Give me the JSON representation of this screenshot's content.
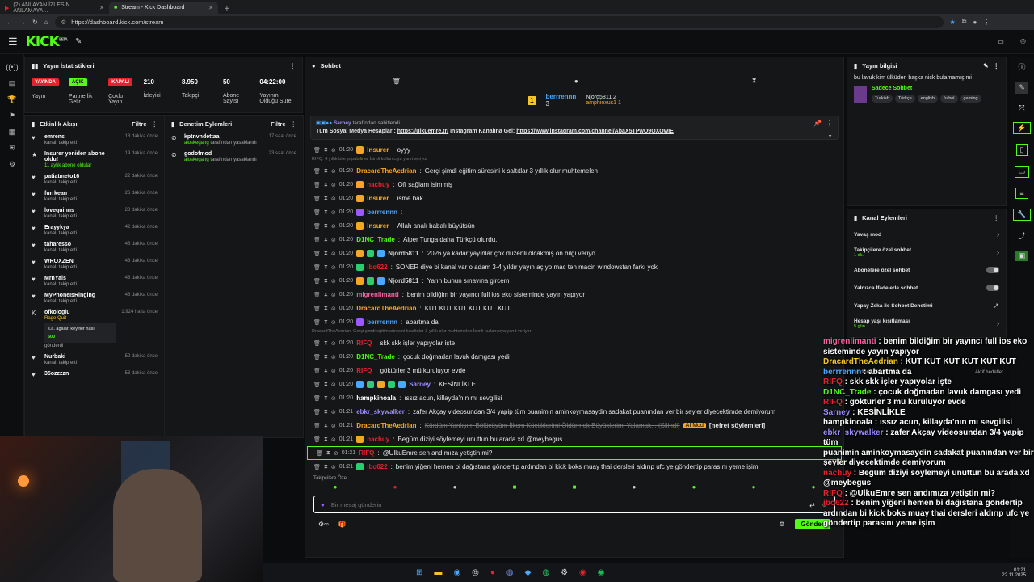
{
  "browser": {
    "tabs": [
      {
        "label": "(2) ANLAYAN İZLESİN ANLAMAYA..."
      },
      {
        "label": "Stream - Kick Dashboard"
      }
    ],
    "url": "https://dashboard.kick.com/stream"
  },
  "header": {
    "logo": "KICK",
    "logo_badge": "BETA"
  },
  "stats": {
    "title": "Yayın İstatistikleri",
    "items": [
      {
        "badge": "YAYINDA",
        "color": "#e5232d",
        "label": "Yayın"
      },
      {
        "badge": "AÇIK",
        "color": "#53fc18",
        "label": "Partnerlik Gelir"
      },
      {
        "badge": "KAPALI",
        "color": "#e5232d",
        "label": "Çoklu Yayın"
      },
      {
        "value": "210",
        "label": "İzleyici"
      },
      {
        "value": "8.950",
        "label": "Takipçi"
      },
      {
        "value": "50",
        "label": "Abone Sayısı"
      },
      {
        "value": "04:22:00",
        "label": "Yayının Olduğu Süre"
      }
    ]
  },
  "activity": {
    "title": "Etkinlik Akışı",
    "filter": "Filtre",
    "items": [
      {
        "icon": "♥",
        "name": "emrens",
        "desc": "kanalı takip etti",
        "time": "18 dakika önce"
      },
      {
        "icon": "★",
        "name": "Insurer yeniden abone oldu!",
        "desc": "11 aylık abone oldular",
        "time": "19 dakika önce",
        "green": true
      },
      {
        "icon": "♥",
        "name": "patiatmeto16",
        "desc": "kanalı takip etti",
        "time": "22 dakika önce"
      },
      {
        "icon": "♥",
        "name": "furrkean",
        "desc": "kanalı takip etti",
        "time": "26 dakika önce"
      },
      {
        "icon": "♥",
        "name": "lovequinns",
        "desc": "kanalı takip etti",
        "time": "28 dakika önce"
      },
      {
        "icon": "♥",
        "name": "Erayykya",
        "desc": "kanalı takip etti",
        "time": "42 dakika önce"
      },
      {
        "icon": "♥",
        "name": "taharesso",
        "desc": "kanalı takip etti",
        "time": "43 dakika önce"
      },
      {
        "icon": "♥",
        "name": "WROXZEN",
        "desc": "kanalı takip etti",
        "time": "43 dakika önce"
      },
      {
        "icon": "♥",
        "name": "MrnYals",
        "desc": "kanalı takip etti",
        "time": "43 dakika önce"
      },
      {
        "icon": "♥",
        "name": "MyPhoneIsRinging",
        "desc": "kanalı takip etti",
        "time": "48 dakika önce"
      }
    ],
    "kick_item": {
      "name": "ofkologlu",
      "sub": "Rage Quit",
      "time": "1.924 hafta önce",
      "msg": "s.a. agalar, keyifler nasıl",
      "amount": "500",
      "desc": "gönderdi"
    },
    "last": {
      "name": "Nurbaki",
      "desc": "kanalı takip etti",
      "time": "52 dakika önce"
    },
    "partial": {
      "name": "35ozzzzn",
      "time": "53 dakika önce"
    }
  },
  "moderation": {
    "title": "Denetim Eylemleri",
    "filter": "Filtre",
    "items": [
      {
        "name": "kptnvndettaa",
        "by": "aloskegang",
        "action": "tarafından yasaklandı",
        "time": "17 saat önce"
      },
      {
        "name": "godofmod",
        "by": "aloskegang",
        "action": "tarafından yasaklandı",
        "time": "23 saat önce"
      }
    ]
  },
  "chat": {
    "title": "Sohbet",
    "leaderboard": {
      "first": {
        "name": "berrrennn",
        "count": "3"
      },
      "second": {
        "name": "Njord5811",
        "count": "2"
      },
      "third": {
        "name": "amphioxus1",
        "count": "1"
      }
    },
    "pinned": {
      "by": "Sarney",
      "by_text": "tarafından sabitlendi",
      "text_pre": "Tüm Sosyal Medya Hesapları: ",
      "link1": "https://ulkuemre.tr/",
      "text_mid": " Instagram Kanalına Gel: ",
      "link2": "https://www.instagram.com/channel/AbaX5TPwO9QXQwIE"
    },
    "messages": [
      {
        "time": "01:20",
        "user": "Insurer",
        "color": "#f5a623",
        "msg": "oyyy",
        "badges": [
          "#f5a623"
        ]
      },
      {
        "reply": "RIFQ: 4 yıllık bile yapabilirler İsimli kullanıcıya yanıt veriyor"
      },
      {
        "time": "01:20",
        "user": "DracardTheAedrian",
        "color": "#f5a623",
        "msg": "Gerçi şimdi eğitim süresini kısaltıtlar 3 yıllık olur muhtemelen",
        "badges": []
      },
      {
        "time": "01:20",
        "user": "nachuy",
        "color": "#e5232d",
        "msg": "Off sağlam isimmiş",
        "badges": [
          "#f5a623"
        ]
      },
      {
        "time": "01:20",
        "user": "Insurer",
        "color": "#f5a623",
        "msg": "isme bak",
        "badges": [
          "#f5a623"
        ]
      },
      {
        "time": "01:20",
        "user": "berrrennn",
        "color": "#4aa8ff",
        "msg": "",
        "badges": [
          "#9b59ff"
        ]
      },
      {
        "time": "01:20",
        "user": "Insurer",
        "color": "#f5a623",
        "msg": "Allah analı babalı büyütsün",
        "badges": [
          "#f5a623"
        ]
      },
      {
        "time": "01:20",
        "user": "D1NC_Trade",
        "color": "#53fc18",
        "msg": "Alper Tunga daha Türkçü olurdu..",
        "badges": []
      },
      {
        "time": "01:20",
        "user": "Njord5811",
        "color": "#cccccc",
        "msg": "2026 ya kadar yayınlar çok düzenli olcakmış ön bilgi veriyo",
        "badges": [
          "#f5a623",
          "#2ecc71",
          "#4aa8ff"
        ]
      },
      {
        "time": "01:20",
        "user": "ibo622",
        "color": "#e5232d",
        "msg": "SONER diye bi kanal var o adam 3-4 yıldır yayın açıyo mac ten macin windowstan farkı yok",
        "badges": [
          "#2ecc71"
        ]
      },
      {
        "time": "01:20",
        "user": "Njord5811",
        "color": "#cccccc",
        "msg": "Yarın bunun sınavına gircem",
        "badges": [
          "#f5a623",
          "#2ecc71",
          "#4aa8ff"
        ]
      },
      {
        "time": "01:20",
        "user": "migrenlimanti",
        "color": "#ff5fa2",
        "msg": "benim bildiğim bir yayıncı full ios eko sisteminde yayın yapıyor",
        "badges": []
      },
      {
        "time": "01:20",
        "user": "DracardTheAedrian",
        "color": "#f5a623",
        "msg": "KUT KUT KUT KUT KUT KUT",
        "badges": []
      },
      {
        "time": "01:20",
        "user": "berrrennn",
        "color": "#4aa8ff",
        "msg": "abartma da",
        "badges": [
          "#9b59ff"
        ]
      },
      {
        "reply": "DracardTheAedrian: Gerçi şimdi eğitim süresini kısaltıtlar 3 yıllık olur muhtemelen İsimli kullanıcıya yanıt veriyor"
      },
      {
        "time": "01:20",
        "user": "RIFQ",
        "color": "#e5232d",
        "msg": "skk skk işler yapıyolar işte",
        "badges": []
      },
      {
        "time": "01:20",
        "user": "D1NC_Trade",
        "color": "#53fc18",
        "msg": "çocuk doğmadan lavuk damgası yedi",
        "badges": []
      },
      {
        "time": "01:20",
        "user": "RIFQ",
        "color": "#e5232d",
        "msg": "göktürler 3 mü kuruluyor evde",
        "badges": []
      },
      {
        "time": "01:20",
        "user": "Sarney",
        "color": "#9b8cff",
        "msg": "KESİNLİKLE",
        "badges": [
          "#4aa8ff",
          "#2ecc71",
          "#f5a623",
          "#2ecc71",
          "#4aa8ff"
        ]
      },
      {
        "time": "01:20",
        "user": "hampkinoala",
        "color": "#ffffff",
        "msg": "ıssız acun, killayda'nın mı sevgilisi",
        "badges": []
      },
      {
        "time": "01:21",
        "user": "ebkr_skywalker",
        "color": "#9b8cff",
        "msg": "zafer Akçay videosundan 3/4 yapip tüm puanimin aminkoymasaydin sadakat puanından ver bir şeyler diyecektimde demiyorum",
        "badges": []
      },
      {
        "time": "01:21",
        "user": "DracardTheAedrian",
        "color": "#f5a623",
        "msg": "Kürdüm Yanlışım Bölücüyüm İlkem Küçüklerimi Öldürmek Büyüklerimi Yalamak... (Silindi)",
        "badges": [],
        "deleted": true,
        "mod": "AI Mod",
        "tag": "[nefret söylemleri]"
      },
      {
        "time": "01:21",
        "user": "nachuy",
        "color": "#e5232d",
        "msg": "Begüm diziyi söylemeyi unuttun bu arada xd @meybegus",
        "badges": [
          "#f5a623"
        ]
      },
      {
        "time": "01:21",
        "user": "RIFQ",
        "color": "#e5232d",
        "msg": "@UlkuEmre sen andımıza yetiştin mi?",
        "badges": [],
        "highlight": true
      },
      {
        "time": "01:21",
        "user": "ibo622",
        "color": "#e5232d",
        "msg": "benim yiğeni hemen bi dağıstana göndertip ardından bi kick boks muay thai dersleri aldırıp ufc ye göndertip parasını yeme işim",
        "badges": [
          "#2ecc71"
        ]
      }
    ],
    "followers_label": "Takipçilere Özel",
    "input_placeholder": "Bir mesaj gönderin",
    "send_label": "Gönder"
  },
  "stream_info": {
    "title": "Yayın bilgisi",
    "stream_title": "bu lavuk kim ülküden başka nick bulamamış mi",
    "category": "Sadece Sohbet",
    "tags": [
      "Turkish",
      "Türkçe",
      "english",
      "futbol",
      "gaming"
    ]
  },
  "channel_actions": {
    "title": "Kanal Eylemleri",
    "items": [
      {
        "label": "Yavaş mod",
        "type": "arrow"
      },
      {
        "label": "Takipçilere özel sohbet",
        "sub": "1 dk.",
        "type": "arrow"
      },
      {
        "label": "Abonelere özel sohbet",
        "type": "toggle"
      },
      {
        "label": "Yalnızca İfadelerle sohbet",
        "type": "toggle"
      },
      {
        "label": "Yapay Zeka ile Sohbet Denetimi",
        "type": "link"
      },
      {
        "label": "Hesap yaşı kısıtlaması",
        "sub": "5 gün",
        "type": "arrow"
      }
    ],
    "hidden_label": "Hedefleri belirleyin",
    "hidden_status": "Aktif hedefler"
  },
  "overlay": {
    "lines": [
      {
        "user": "migrenlimanti",
        "color": "#ff5fa2",
        "msg": " : benim bildiğim bir yayıncı full ios eko"
      },
      {
        "user": "",
        "msg": "sisteminde yayın yapıyor"
      },
      {
        "user": "DracardTheAedrian",
        "color": "#f5c623",
        "msg": " : KUT KUT KUT KUT KUT KUT"
      },
      {
        "user": "berrrennn",
        "color": "#4aa8ff",
        "msg": " : abartma da"
      },
      {
        "user": "RIFQ",
        "color": "#e5232d",
        "msg": " : skk skk işler yapıyolar işte"
      },
      {
        "user": "D1NC_Trade",
        "color": "#53fc18",
        "msg": " : çocuk doğmadan lavuk damgası yedi"
      },
      {
        "user": "RIFQ",
        "color": "#e5232d",
        "msg": " : göktürler 3 mü kuruluyor evde"
      },
      {
        "user": "Sarney",
        "color": "#9b8cff",
        "msg": " : KESİNLİKLE"
      },
      {
        "user": "hampkinoala",
        "color": "#ffffff",
        "msg": " : ıssız acun, killayda'nın mı sevgilisi"
      },
      {
        "user": "ebkr_skywalker",
        "color": "#9b8cff",
        "msg": " : zafer Akçay videosundan 3/4 yapip tüm"
      },
      {
        "user": "",
        "msg": "puanimin aminkoymasaydin sadakat puanından ver bir"
      },
      {
        "user": "",
        "msg": "şeyler diyecektimde demiyorum"
      },
      {
        "user": "nachuy",
        "color": "#e5232d",
        "msg": " : Begüm diziyi söylemeyi unuttun bu arada xd"
      },
      {
        "user": "",
        "msg": "@meybegus"
      },
      {
        "user": "RIFQ",
        "color": "#e5232d",
        "msg": " : @UlkuEmre sen andımıza yetiştin mi?"
      },
      {
        "user": "ibo622",
        "color": "#e5232d",
        "msg": " : benim yiğeni hemen bi dağıstana göndertip"
      },
      {
        "user": "",
        "msg": "ardından bi kick boks muay thai dersleri aldırıp ufc ye"
      },
      {
        "user": "",
        "msg": "göndertip parasını yeme işim"
      }
    ]
  },
  "taskbar": {
    "time": "01:21",
    "date": "22.11.2025"
  }
}
